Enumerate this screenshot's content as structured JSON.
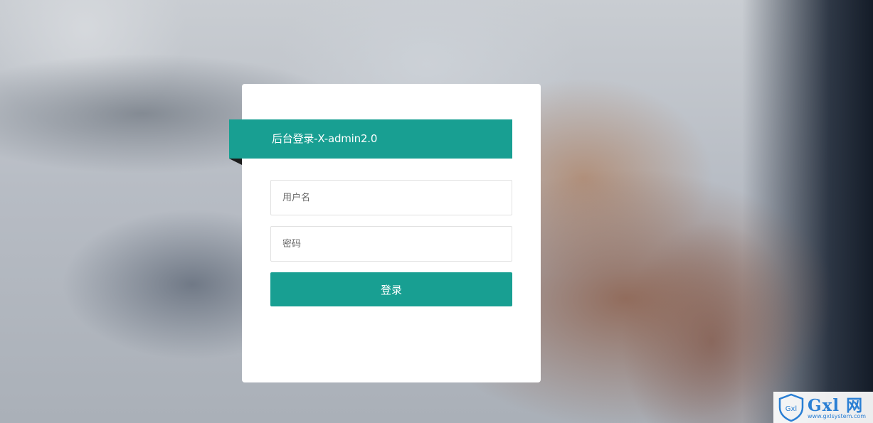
{
  "login": {
    "title": "后台登录-X-admin2.0",
    "username_placeholder": "用户名",
    "password_placeholder": "密码",
    "submit_label": "登录"
  },
  "colors": {
    "accent": "#189f92",
    "card": "#ffffff"
  },
  "watermark": {
    "title": "Gxl 网",
    "url": "www.gxlsystem.com",
    "badge": "Gxl"
  }
}
